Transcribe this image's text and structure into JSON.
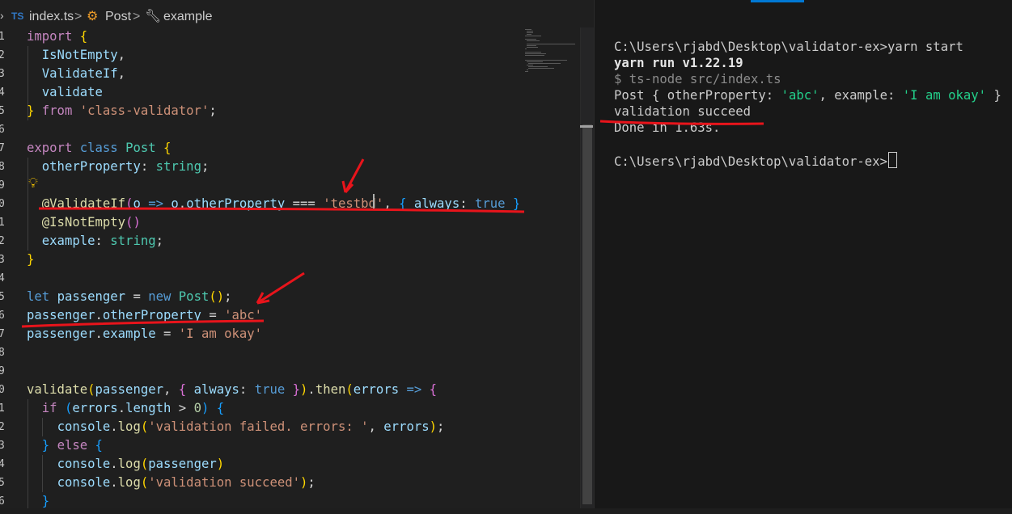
{
  "breadcrumb": {
    "file_badge": "TS",
    "file_name": "index.ts",
    "sep1": ">",
    "item2": "Post",
    "sep2": ">",
    "item3": "example"
  },
  "editor": {
    "lines": [
      [
        [
          "kw-i",
          "import"
        ],
        [
          "plain",
          " "
        ],
        [
          "brk-y",
          "{"
        ]
      ],
      [
        [
          "plain",
          "  "
        ],
        [
          "var",
          "IsNotEmpty"
        ],
        [
          "plain",
          ","
        ]
      ],
      [
        [
          "plain",
          "  "
        ],
        [
          "var",
          "ValidateIf"
        ],
        [
          "plain",
          ","
        ]
      ],
      [
        [
          "plain",
          "  "
        ],
        [
          "var",
          "validate"
        ]
      ],
      [
        [
          "brk-y",
          "}"
        ],
        [
          "plain",
          " "
        ],
        [
          "kw-i",
          "from"
        ],
        [
          "plain",
          " "
        ],
        [
          "str",
          "'class-validator'"
        ],
        [
          "plain",
          ";"
        ]
      ],
      [],
      [
        [
          "kw-i",
          "export"
        ],
        [
          "plain",
          " "
        ],
        [
          "kw-b",
          "class"
        ],
        [
          "plain",
          " "
        ],
        [
          "cls",
          "Post"
        ],
        [
          "plain",
          " "
        ],
        [
          "brk-y",
          "{"
        ]
      ],
      [
        [
          "plain",
          "  "
        ],
        [
          "var",
          "otherProperty"
        ],
        [
          "plain",
          ": "
        ],
        [
          "cls",
          "string"
        ],
        [
          "plain",
          ";"
        ]
      ],
      [],
      [
        [
          "plain",
          "  "
        ],
        [
          "fn",
          "@ValidateIf"
        ],
        [
          "brk-p",
          "("
        ],
        [
          "var",
          "o"
        ],
        [
          "plain",
          " "
        ],
        [
          "kw-b",
          "=>"
        ],
        [
          "plain",
          " "
        ],
        [
          "var",
          "o"
        ],
        [
          "plain",
          "."
        ],
        [
          "var",
          "otherProperty"
        ],
        [
          "plain",
          " === "
        ],
        [
          "str",
          "'testbd'"
        ],
        [
          "plain",
          ", "
        ],
        [
          "brk-b",
          "{"
        ],
        [
          "plain",
          " "
        ],
        [
          "var",
          "always"
        ],
        [
          "plain",
          ": "
        ],
        [
          "kw-b",
          "true"
        ],
        [
          "plain",
          " "
        ],
        [
          "brk-b",
          "}"
        ],
        [
          "brk-p",
          ")"
        ]
      ],
      [
        [
          "plain",
          "  "
        ],
        [
          "fn",
          "@IsNotEmpty"
        ],
        [
          "brk-p",
          "()"
        ]
      ],
      [
        [
          "plain",
          "  "
        ],
        [
          "var",
          "example"
        ],
        [
          "plain",
          ": "
        ],
        [
          "cls",
          "string"
        ],
        [
          "plain",
          ";"
        ]
      ],
      [
        [
          "brk-y",
          "}"
        ]
      ],
      [],
      [
        [
          "kw-b",
          "let"
        ],
        [
          "plain",
          " "
        ],
        [
          "var",
          "passenger"
        ],
        [
          "plain",
          " = "
        ],
        [
          "kw-b",
          "new"
        ],
        [
          "plain",
          " "
        ],
        [
          "cls",
          "Post"
        ],
        [
          "brk-y",
          "()"
        ],
        [
          "plain",
          ";"
        ]
      ],
      [
        [
          "var",
          "passenger"
        ],
        [
          "plain",
          "."
        ],
        [
          "var",
          "otherProperty"
        ],
        [
          "plain",
          " = "
        ],
        [
          "str",
          "'abc'"
        ]
      ],
      [
        [
          "var",
          "passenger"
        ],
        [
          "plain",
          "."
        ],
        [
          "var",
          "example"
        ],
        [
          "plain",
          " = "
        ],
        [
          "str",
          "'I am okay'"
        ]
      ],
      [],
      [],
      [
        [
          "fn",
          "validate"
        ],
        [
          "brk-y",
          "("
        ],
        [
          "var",
          "passenger"
        ],
        [
          "plain",
          ", "
        ],
        [
          "brk-p",
          "{"
        ],
        [
          "plain",
          " "
        ],
        [
          "var",
          "always"
        ],
        [
          "plain",
          ": "
        ],
        [
          "kw-b",
          "true"
        ],
        [
          "plain",
          " "
        ],
        [
          "brk-p",
          "}"
        ],
        [
          "brk-y",
          ")"
        ],
        [
          "plain",
          "."
        ],
        [
          "fn",
          "then"
        ],
        [
          "brk-y",
          "("
        ],
        [
          "var",
          "errors"
        ],
        [
          "plain",
          " "
        ],
        [
          "kw-b",
          "=>"
        ],
        [
          "plain",
          " "
        ],
        [
          "brk-p",
          "{"
        ]
      ],
      [
        [
          "plain",
          "  "
        ],
        [
          "kw-i",
          "if"
        ],
        [
          "plain",
          " "
        ],
        [
          "brk-b",
          "("
        ],
        [
          "var",
          "errors"
        ],
        [
          "plain",
          "."
        ],
        [
          "var",
          "length"
        ],
        [
          "plain",
          " > "
        ],
        [
          "num",
          "0"
        ],
        [
          "brk-b",
          ")"
        ],
        [
          "plain",
          " "
        ],
        [
          "brk-b",
          "{"
        ]
      ],
      [
        [
          "plain",
          "    "
        ],
        [
          "var",
          "console"
        ],
        [
          "plain",
          "."
        ],
        [
          "fn",
          "log"
        ],
        [
          "brk-y",
          "("
        ],
        [
          "str",
          "'validation failed. errors: '"
        ],
        [
          "plain",
          ", "
        ],
        [
          "var",
          "errors"
        ],
        [
          "brk-y",
          ")"
        ],
        [
          "plain",
          ";"
        ]
      ],
      [
        [
          "plain",
          "  "
        ],
        [
          "brk-b",
          "}"
        ],
        [
          "plain",
          " "
        ],
        [
          "kw-i",
          "else"
        ],
        [
          "plain",
          " "
        ],
        [
          "brk-b",
          "{"
        ]
      ],
      [
        [
          "plain",
          "    "
        ],
        [
          "var",
          "console"
        ],
        [
          "plain",
          "."
        ],
        [
          "fn",
          "log"
        ],
        [
          "brk-y",
          "("
        ],
        [
          "var",
          "passenger"
        ],
        [
          "brk-y",
          ")"
        ]
      ],
      [
        [
          "plain",
          "    "
        ],
        [
          "var",
          "console"
        ],
        [
          "plain",
          "."
        ],
        [
          "fn",
          "log"
        ],
        [
          "brk-y",
          "("
        ],
        [
          "str",
          "'validation succeed'"
        ],
        [
          "brk-y",
          ")"
        ],
        [
          "plain",
          ";"
        ]
      ],
      [
        [
          "plain",
          "  "
        ],
        [
          "brk-b",
          "}"
        ]
      ]
    ],
    "line_number_glyphs": [
      "1",
      "2",
      "3",
      "4",
      "5",
      "6",
      "7",
      "8",
      "9",
      "0",
      "1",
      "2",
      "3",
      "4",
      "5",
      "6",
      "7",
      "8",
      "9",
      "0",
      "1",
      "2",
      "3",
      "4",
      "5",
      "6"
    ]
  },
  "terminal": {
    "lines": [
      {
        "text": "C:\\Users\\rjabd\\Desktop\\validator-ex>yarn start",
        "style": "normal"
      },
      {
        "text": "yarn run v1.22.19",
        "style": "bold"
      },
      {
        "text": "$ ts-node src/index.ts",
        "style": "dim"
      },
      {
        "text": "",
        "style": "post"
      },
      {
        "text": "validation succeed",
        "style": "normal"
      },
      {
        "text": "Done in 1.63s.",
        "style": "normal"
      },
      {
        "text": "",
        "style": "normal"
      },
      {
        "text": "C:\\Users\\rjabd\\Desktop\\validator-ex>",
        "style": "prompt"
      }
    ],
    "post_output": [
      [
        "plain",
        "Post { "
      ],
      [
        "var",
        "otherProperty"
      ],
      [
        "plain",
        ": "
      ],
      [
        "str-g",
        "'abc'"
      ],
      [
        "plain",
        ", "
      ],
      [
        "var",
        "example"
      ],
      [
        "plain",
        ": "
      ],
      [
        "str-g",
        "'I am okay'"
      ],
      [
        "plain",
        " }"
      ]
    ]
  },
  "colors": {
    "annotation_red": "#e8141b",
    "terminal_string": "#23d18b"
  },
  "icons": [
    "chevron-right-icon",
    "symbol-class-icon",
    "symbol-property-icon",
    "lightbulb-icon"
  ]
}
